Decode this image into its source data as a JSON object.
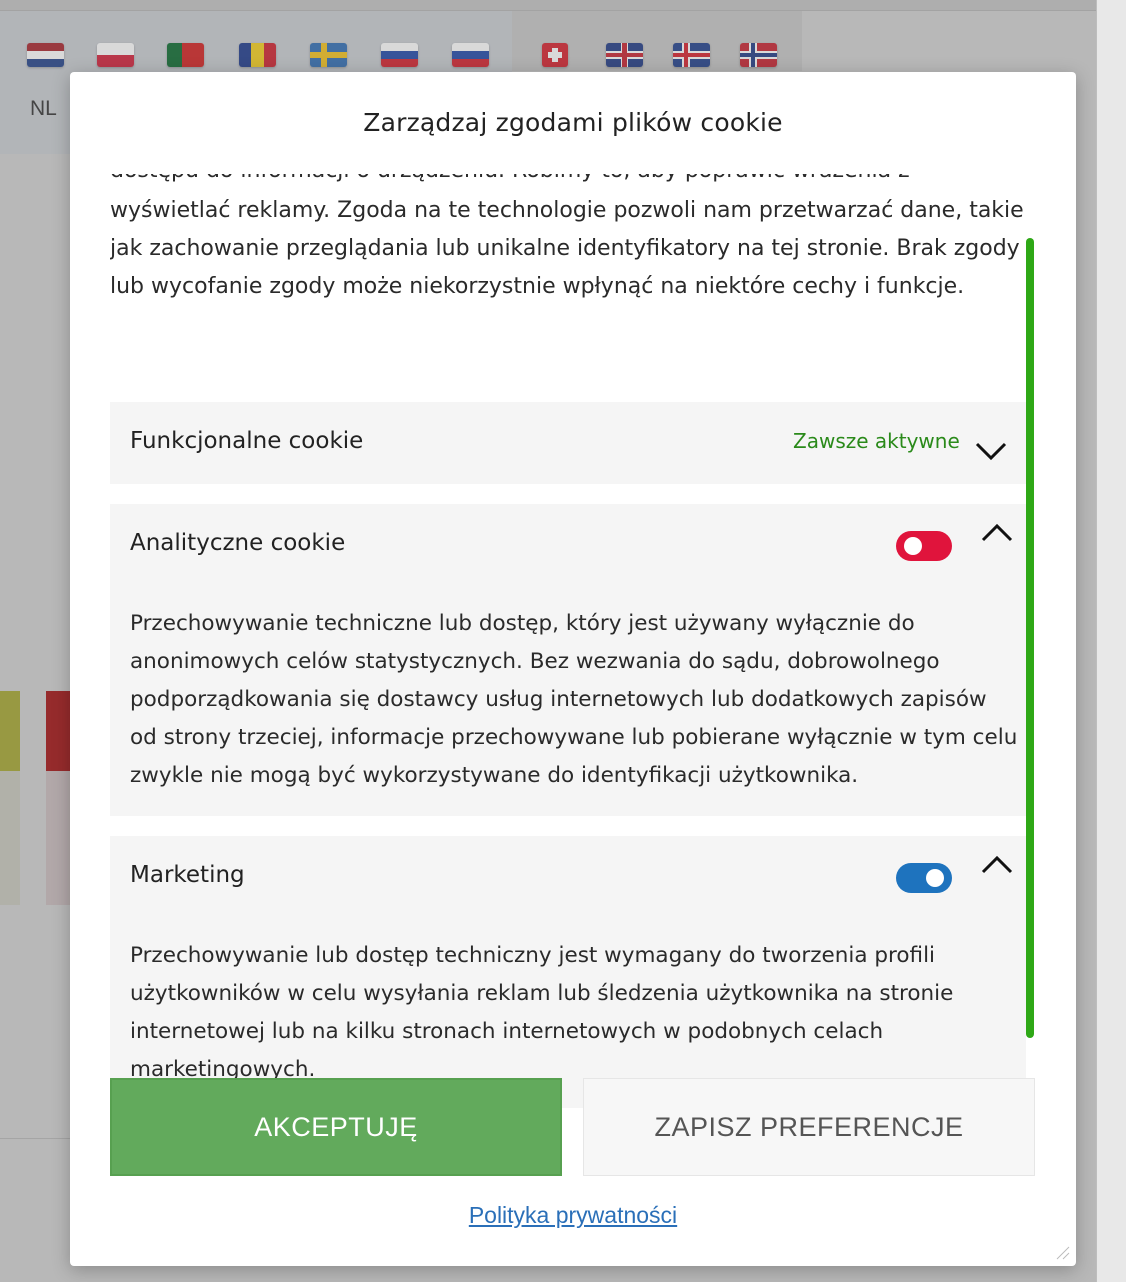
{
  "background": {
    "language_code": "NL",
    "flags": [
      "netherlands-flag",
      "poland-flag",
      "portugal-flag",
      "romania-flag",
      "sweden-flag",
      "slovenia-flag",
      "slovakia-flag",
      "switzerland-flag",
      "uk-flag",
      "iceland-flag",
      "norway-flag"
    ]
  },
  "modal": {
    "title": "Zarządzaj zgodami plików cookie",
    "intro_partial_line": "dostępu do informacji o urządzeniu. Robimy to, aby poprawić wrażenia z przeglądania i",
    "intro_rest": "wyświetlać reklamy. Zgoda na te technologie pozwoli nam przetwarzać dane, takie jak zachowanie przeglądania lub unikalne identyfikatory na tej stronie. Brak zgody lub wycofanie zgody może niekorzystnie wpłynąć na niektóre cechy i funkcje.",
    "categories": [
      {
        "title": "Funkcjonalne cookie",
        "status": "Zawsze aktywne",
        "expanded": false
      },
      {
        "title": "Analityczne cookie",
        "enabled": false,
        "toggle_color": "#e0143c",
        "expanded": true,
        "description": "Przechowywanie techniczne lub dostęp, który jest używany wyłącznie do anonimowych celów statystycznych. Bez wezwania do sądu, dobrowolnego podporządkowania się dostawcy usług internetowych lub dodatkowych zapisów od strony trzeciej, informacje przechowywane lub pobierane wyłącznie w tym celu zwykle nie mogą być wykorzystywane do identyfikacji użytkownika."
      },
      {
        "title": "Marketing",
        "enabled": true,
        "toggle_color": "#1e73be",
        "expanded": true,
        "description": "Przechowywanie lub dostęp techniczny jest wymagany do tworzenia profili użytkowników w celu wysyłania reklam lub śledzenia użytkownika na stronie internetowej lub na kilku stronach internetowych w podobnych celach marketingowych."
      }
    ],
    "accept_label": "AKCEPTUJĘ",
    "save_label": "ZAPISZ PREFERENCJE",
    "policy_link": "Polityka prywatności"
  },
  "colors": {
    "accent_green": "#62aa5c",
    "scrollbar": "#2ea816",
    "link": "#2a6fb8"
  }
}
